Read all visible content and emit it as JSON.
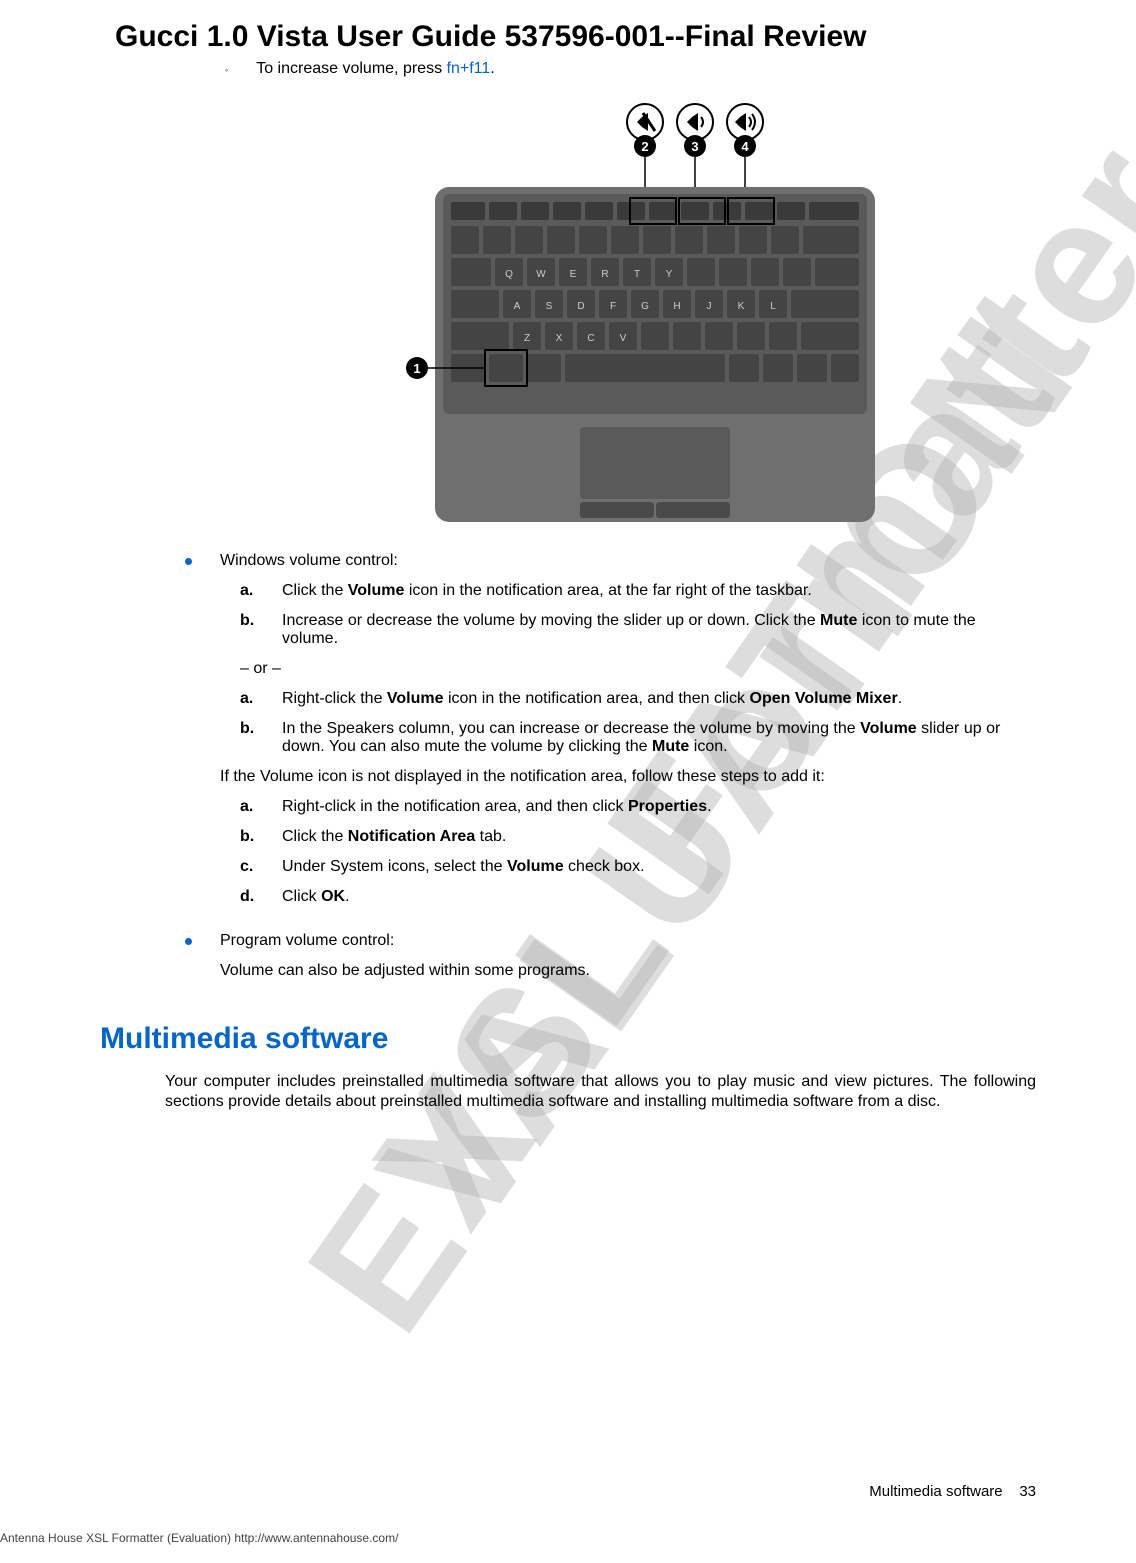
{
  "title": "Gucci 1.0 Vista User Guide 537596-001--Final Review",
  "watermark1": "XSL Formatter",
  "watermark2": "EVALUATION",
  "volume_increase": {
    "prefix": "To increase volume, press ",
    "key": "fn+f11",
    "suffix": "."
  },
  "windows_volume_header": "Windows volume control:",
  "steps1": {
    "a": {
      "enum": "a.",
      "pre": "Click the ",
      "b1": "Volume",
      "post": " icon in the notification area, at the far right of the taskbar."
    },
    "b": {
      "enum": "b.",
      "pre": "Increase or decrease the volume by moving the slider up or down. Click the ",
      "b1": "Mute",
      "post": " icon to mute the volume."
    }
  },
  "or_text": "– or –",
  "steps2": {
    "a": {
      "enum": "a.",
      "pre": "Right-click the ",
      "b1": "Volume",
      "mid": " icon in the notification area, and then click ",
      "b2": "Open Volume Mixer",
      "post": "."
    },
    "b": {
      "enum": "b.",
      "pre": "In the Speakers column, you can increase or decrease the volume by moving the ",
      "b1": "Volume",
      "mid": " slider up or down. You can also mute the volume by clicking the ",
      "b2": "Mute",
      "post": " icon."
    }
  },
  "not_displayed": "If the Volume icon is not displayed in the notification area, follow these steps to add it:",
  "steps3": {
    "a": {
      "enum": "a.",
      "pre": "Right-click in the notification area, and then click ",
      "b1": "Properties",
      "post": "."
    },
    "b": {
      "enum": "b.",
      "pre": "Click the ",
      "b1": "Notification Area",
      "post": " tab."
    },
    "c": {
      "enum": "c.",
      "pre": "Under System icons, select the ",
      "b1": "Volume",
      "post": " check box."
    },
    "d": {
      "enum": "d.",
      "pre": "Click ",
      "b1": "OK",
      "post": "."
    }
  },
  "program_volume_header": "Program volume control:",
  "program_volume_text": "Volume can also be adjusted within some programs.",
  "section_heading": "Multimedia software",
  "section_body": "Your computer includes preinstalled multimedia software that allows you to play music and view pictures. The following sections provide details about preinstalled multimedia software and installing multimedia software from a disc.",
  "footer_section": "Multimedia software",
  "footer_page": "33",
  "footer_eval": "Antenna House XSL Formatter (Evaluation)  http://www.antennahouse.com/"
}
